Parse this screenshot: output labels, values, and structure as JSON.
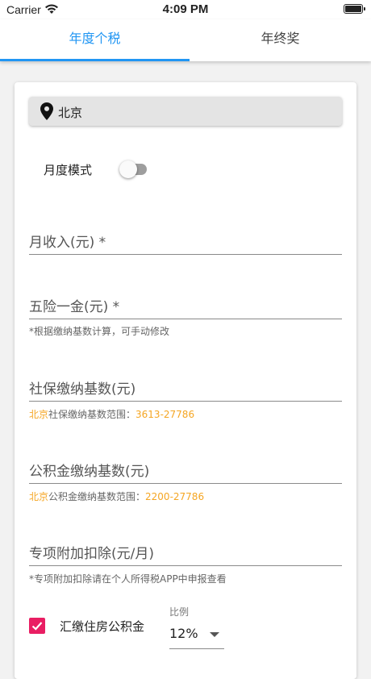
{
  "status_bar": {
    "carrier": "Carrier",
    "time": "4:09 PM"
  },
  "tabs": [
    {
      "label": "年度个税",
      "active": true
    },
    {
      "label": "年终奖",
      "active": false
    }
  ],
  "accent_color": "#2196f3",
  "highlight_color": "#f5a623",
  "city": {
    "name": "北京",
    "icon": "location-pin-icon"
  },
  "monthly_mode": {
    "label": "月度模式",
    "enabled": false
  },
  "fields": {
    "monthly_income": {
      "label": "月收入(元) *",
      "value": ""
    },
    "insurance": {
      "label": "五险一金(元) *",
      "value": "",
      "helper": "*根据缴纳基数计算，可手动修改"
    },
    "social_base": {
      "label": "社保缴纳基数(元)",
      "value": "",
      "helper_city": "北京",
      "helper_text": "社保缴纳基数范围：",
      "helper_range": "3613-27786"
    },
    "fund_base": {
      "label": "公积金缴纳基数(元)",
      "value": "",
      "helper_city": "北京",
      "helper_text": "公积金缴纳基数范围：",
      "helper_range": "2200-27786"
    },
    "special_deduction": {
      "label": "专项附加扣除(元/月)",
      "value": "",
      "helper": "*专项附加扣除请在个人所得税APP中申报查看"
    }
  },
  "housing_fund": {
    "label": "汇缴住房公积金",
    "checked": true,
    "ratio_caption": "比例",
    "ratio_value": "12%"
  }
}
